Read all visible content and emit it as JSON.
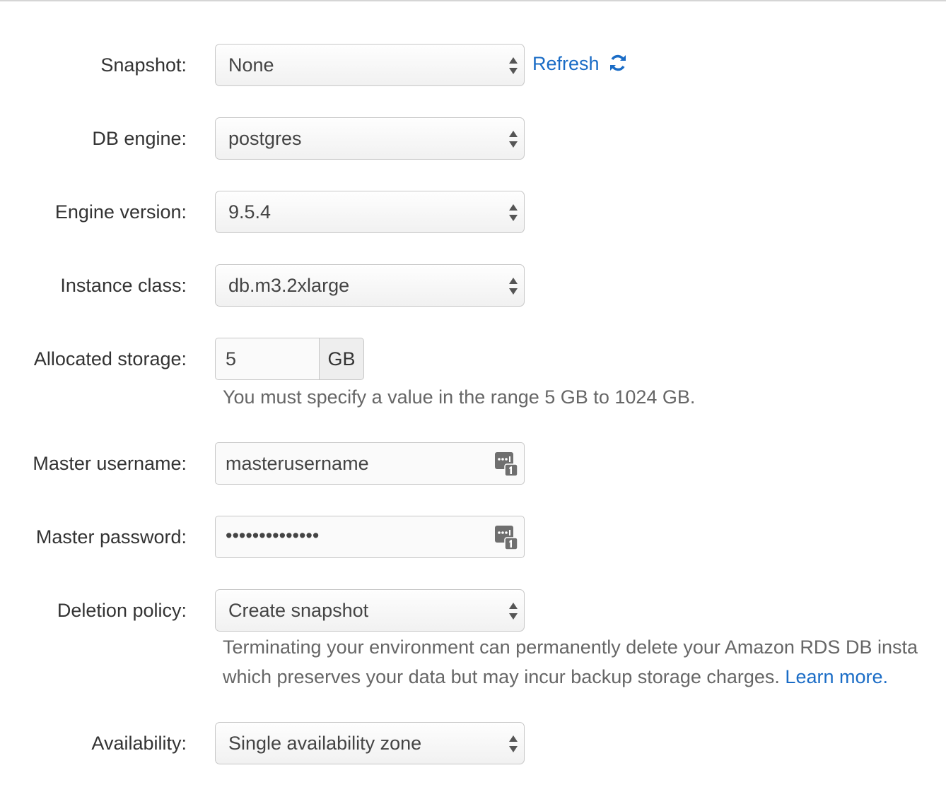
{
  "form": {
    "snapshot": {
      "label": "Snapshot:",
      "value": "None",
      "refresh_label": "Refresh"
    },
    "db_engine": {
      "label": "DB engine:",
      "value": "postgres"
    },
    "engine_version": {
      "label": "Engine version:",
      "value": "9.5.4"
    },
    "instance_class": {
      "label": "Instance class:",
      "value": "db.m3.2xlarge"
    },
    "allocated_storage": {
      "label": "Allocated storage:",
      "value": "5",
      "unit": "GB",
      "help": "You must specify a value in the range 5 GB to 1024 GB."
    },
    "master_username": {
      "label": "Master username:",
      "value": "masterusername"
    },
    "master_password": {
      "label": "Master password:",
      "value": "••••••••••••••"
    },
    "deletion_policy": {
      "label": "Deletion policy:",
      "value": "Create snapshot",
      "help_line1": "Terminating your environment can permanently delete your Amazon RDS DB insta",
      "help_line2": "which preserves your data but may incur backup storage charges.",
      "learn_more": "Learn more."
    },
    "availability": {
      "label": "Availability:",
      "value": "Single availability zone"
    }
  },
  "icons": {
    "select_arrows": "up-down-arrows-icon",
    "refresh": "refresh-icon",
    "password_manager": "password-manager-icon"
  },
  "colors": {
    "link": "#1a6cc6",
    "label": "#333333",
    "help": "#666666"
  }
}
